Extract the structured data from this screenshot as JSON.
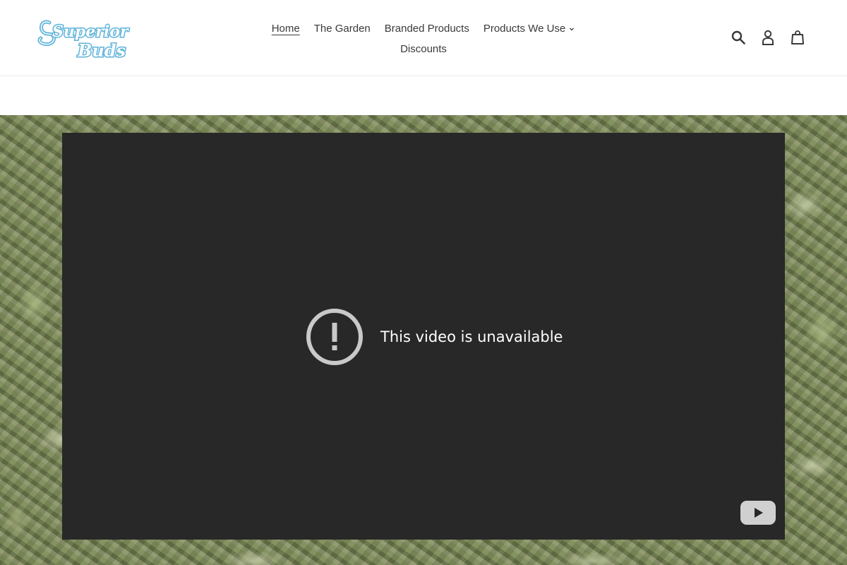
{
  "brand": {
    "logo_line1": "Superior",
    "logo_line2": "Buds",
    "logo_color": "#5fb3d9"
  },
  "nav": {
    "row1": [
      {
        "label": "Home",
        "active": true
      },
      {
        "label": "The Garden",
        "active": false
      },
      {
        "label": "Branded Products",
        "active": false
      },
      {
        "label": "Products We Use",
        "active": false,
        "has_dropdown": true
      }
    ],
    "row2": [
      {
        "label": "Discounts",
        "active": false
      }
    ]
  },
  "header_icons": [
    "search-icon",
    "account-icon",
    "cart-icon"
  ],
  "video": {
    "message": "This video is unavailable",
    "status_icon": "alert-circle-icon",
    "player_icon": "youtube-logo-icon",
    "background": "#282828"
  }
}
